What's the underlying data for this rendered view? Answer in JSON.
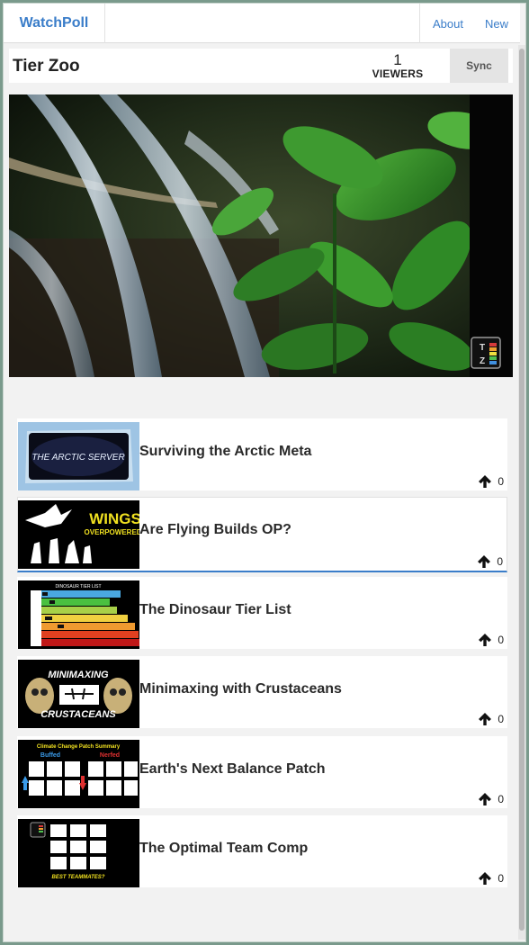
{
  "navbar": {
    "brand": "WatchPoll",
    "links": [
      "About",
      "New"
    ]
  },
  "room": {
    "title": "Tier Zoo",
    "viewer_count": "1",
    "viewer_label": "VIEWERS",
    "sync_label": "Sync"
  },
  "player": {
    "watermark_icon": "tier-zoo-logo"
  },
  "playlist": [
    {
      "title": "Surviving the Arctic Meta",
      "votes": "0",
      "thumb_text": "THE ARCTIC SERVER"
    },
    {
      "title": "Are Flying Builds OP?",
      "votes": "0",
      "thumb_text": [
        "WINGS",
        "OVERPOWERED?"
      ]
    },
    {
      "title": "The Dinosaur Tier List",
      "votes": "0",
      "thumb_text": "DINOSAUR TIER LIST"
    },
    {
      "title": "Minimaxing with Crustaceans",
      "votes": "0",
      "thumb_text": [
        "MINIMAXING",
        "CRUSTACEANS"
      ]
    },
    {
      "title": "Earth's Next Balance Patch",
      "votes": "0",
      "thumb_text": [
        "Climate Change Patch Summary",
        "Buffed",
        "Nerfed"
      ]
    },
    {
      "title": "The Optimal Team Comp",
      "votes": "0",
      "thumb_text": "BEST TEAMMATES?"
    }
  ],
  "colors": {
    "brand": "#3a7dc9",
    "selected_border": "#3a7dc9",
    "background": "#f2f2f2"
  }
}
